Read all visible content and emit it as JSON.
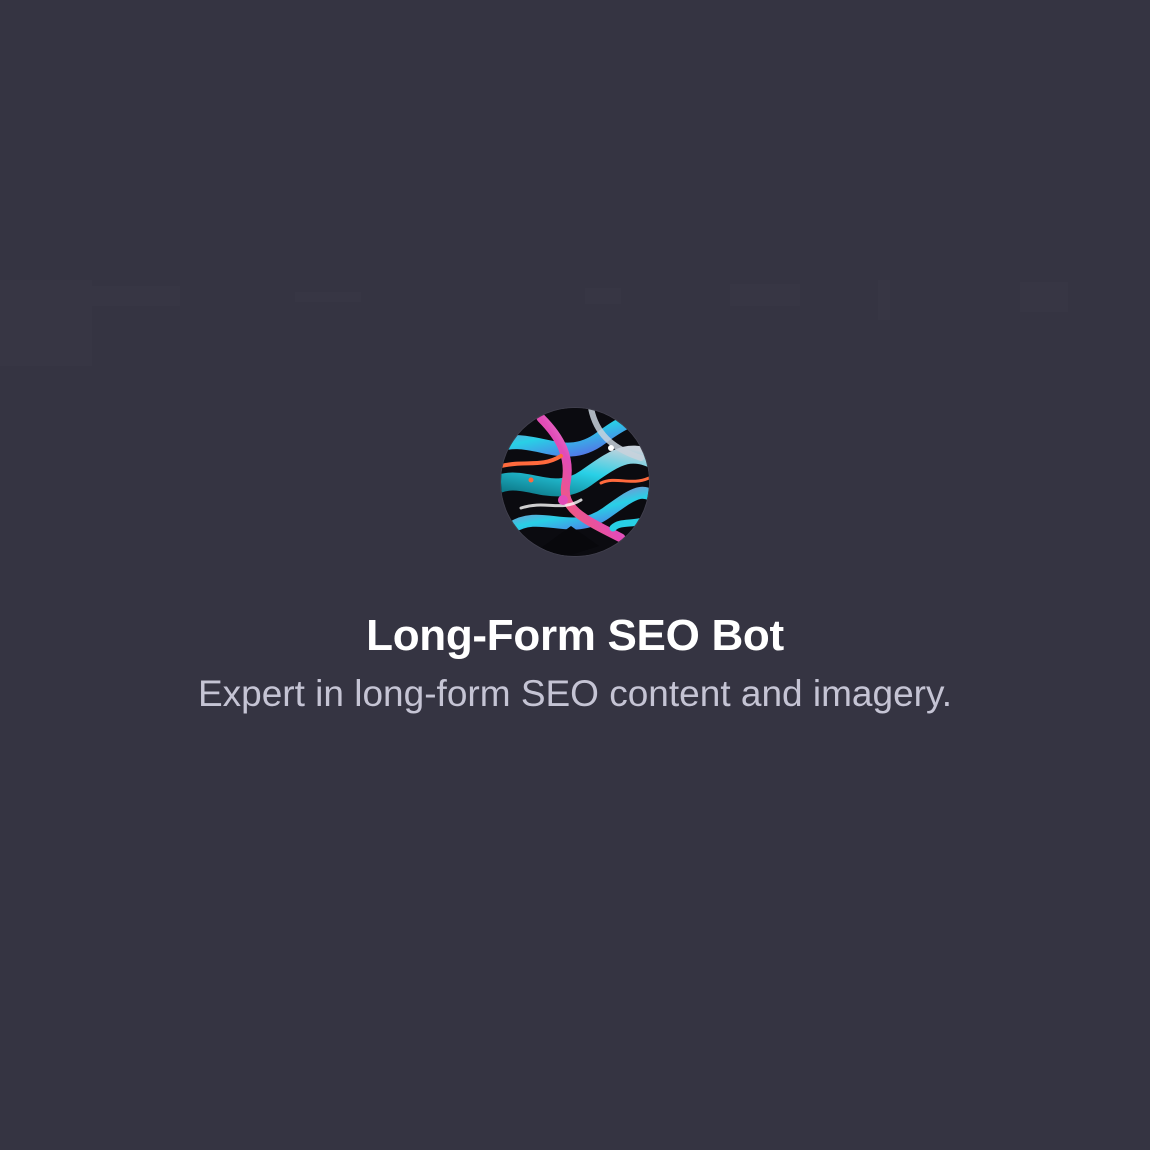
{
  "app": {
    "name": "Long-Form SEO Bot",
    "description": "Expert in long-form SEO content and imagery."
  },
  "avatar": {
    "icon": "abstract-neon-swirl-avatar",
    "colors": [
      "#0b0b10",
      "#28d0e6",
      "#e24bb8",
      "#c9d2dc",
      "#ff6a3d",
      "#6a48e8"
    ]
  },
  "theme": {
    "background": "#353442",
    "title_color": "#ffffff",
    "subtitle_color": "#c5c4d4"
  }
}
